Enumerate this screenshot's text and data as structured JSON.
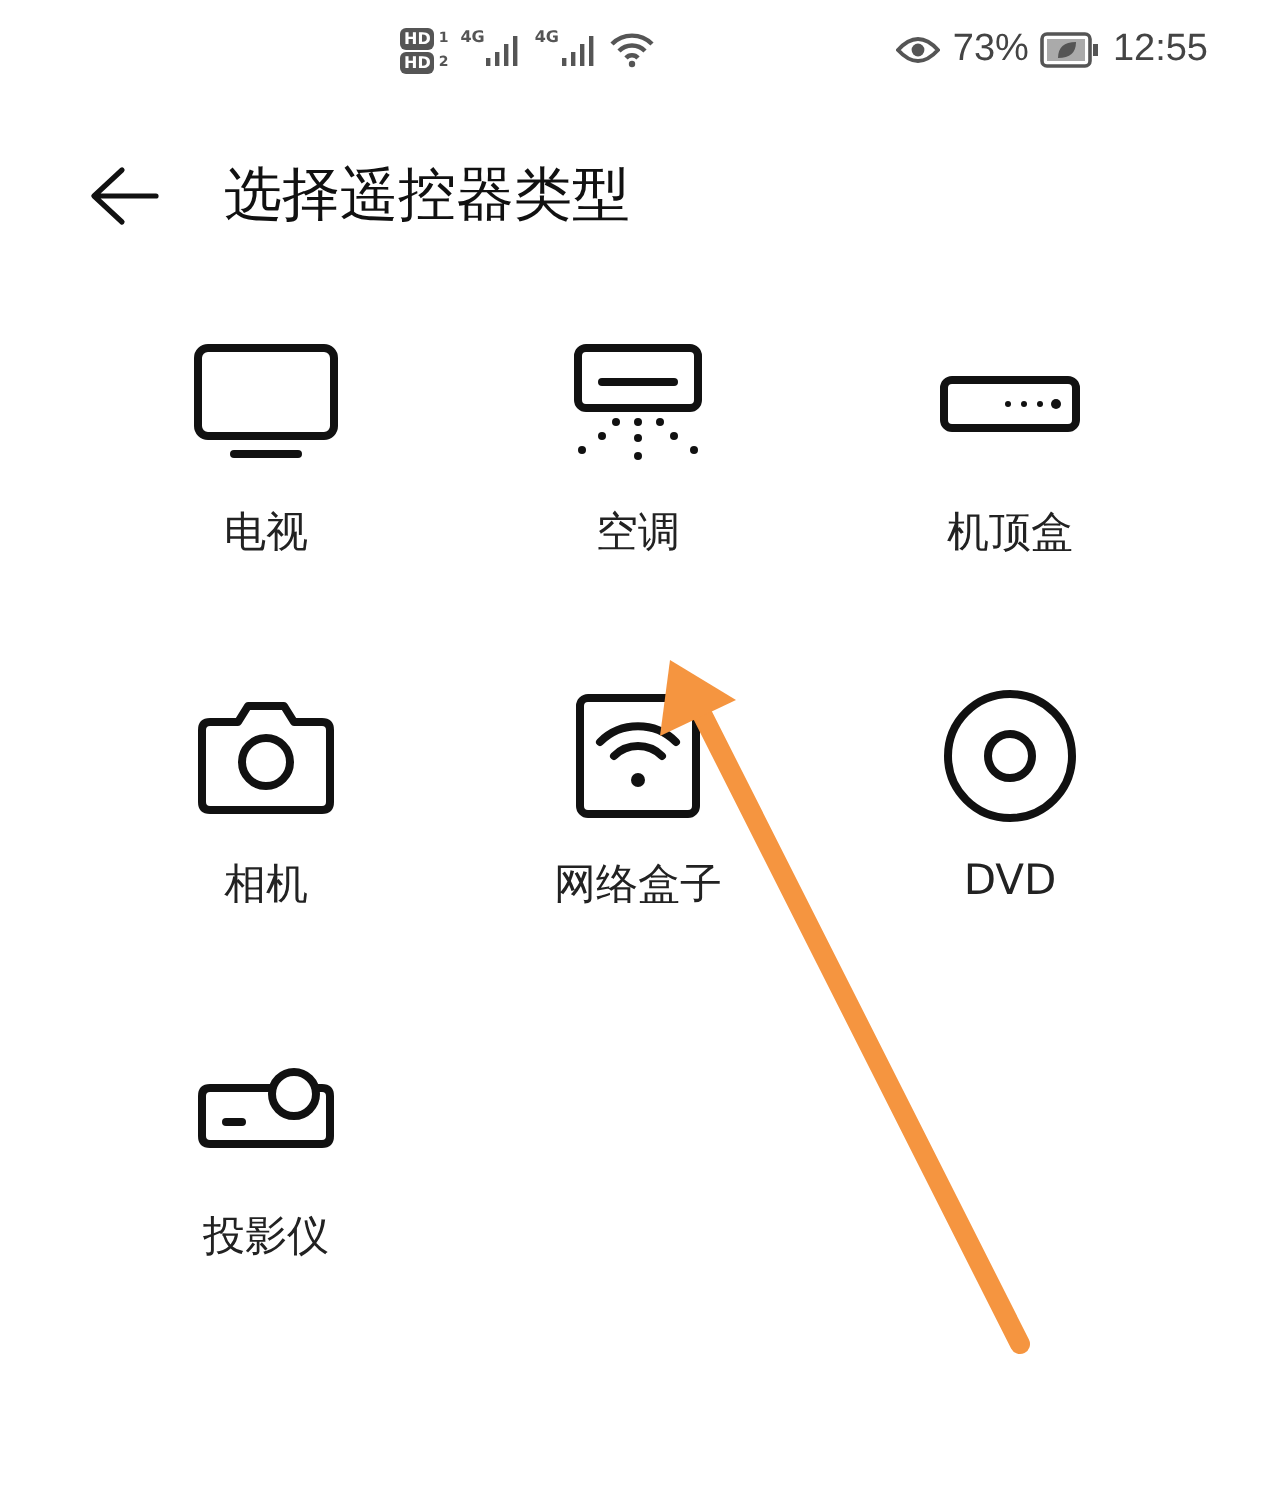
{
  "status_bar": {
    "sim_badges": [
      {
        "label": "HD",
        "slot": "1"
      },
      {
        "label": "HD",
        "slot": "2"
      }
    ],
    "networks": [
      "4G",
      "4G"
    ],
    "battery_percent": "73%",
    "time": "12:55"
  },
  "header": {
    "title": "选择遥控器类型"
  },
  "devices": [
    {
      "kind": "tv",
      "label": "电视"
    },
    {
      "kind": "ac",
      "label": "空调"
    },
    {
      "kind": "settopbox",
      "label": "机顶盒"
    },
    {
      "kind": "camera",
      "label": "相机"
    },
    {
      "kind": "netbox",
      "label": "网络盒子"
    },
    {
      "kind": "dvd",
      "label": "DVD"
    },
    {
      "kind": "projector",
      "label": "投影仪"
    }
  ],
  "annotation": {
    "kind": "arrow"
  }
}
